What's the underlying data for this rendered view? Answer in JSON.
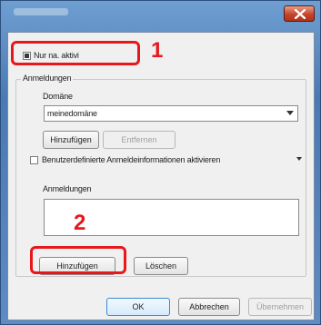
{
  "window": {
    "title": "",
    "close_label": "×"
  },
  "dialog": {
    "top_checkbox_label": "Nur na. aktivi",
    "group_label": "Anmeldungen",
    "field1_label": "Domäne",
    "domain_select_value": "meinedomäne",
    "btn_small_enabled": "Hinzufügen",
    "btn_small_disabled": "Entfernen",
    "option_checkbox_label": "Benutzerdefinierte Anmeldeinformationen aktivieren",
    "text_area_label": "Anmeldungen",
    "add_button": "Hinzufügen",
    "delete_button": "Löschen",
    "ok_button": "OK",
    "cancel_button": "Abbrechen",
    "apply_button": "Übernehmen"
  },
  "annotations": {
    "callout_1": "1",
    "callout_2": "2",
    "highlight_color": "#e8171b"
  }
}
